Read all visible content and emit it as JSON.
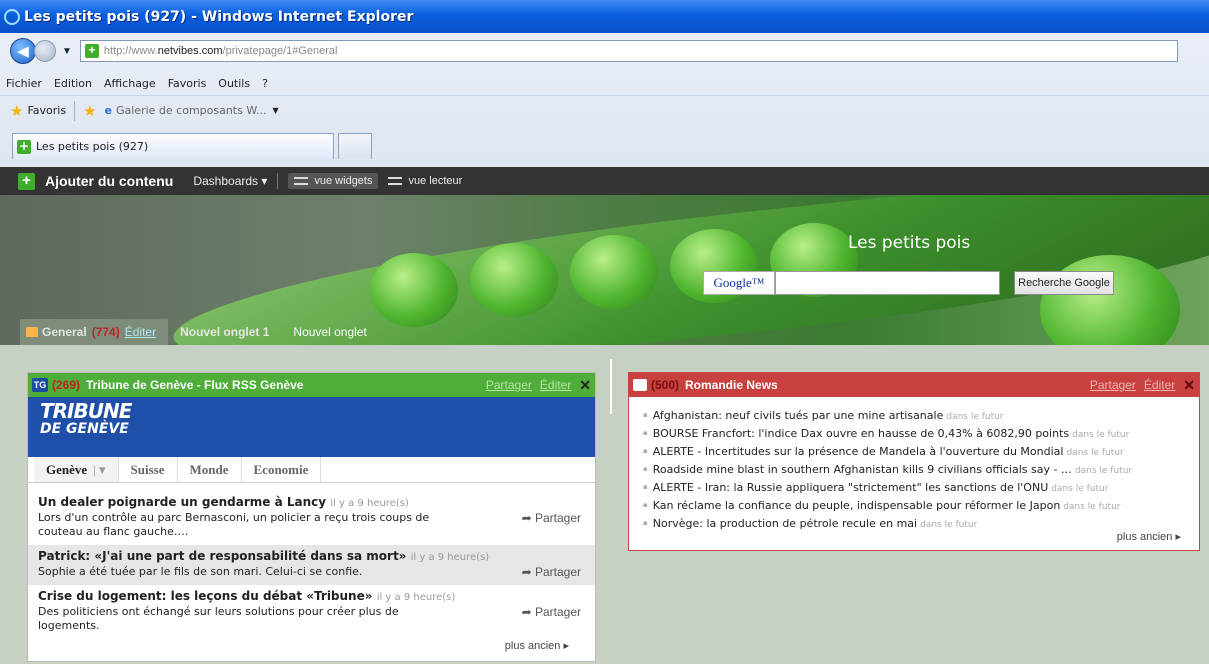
{
  "browser": {
    "title": "Les petits pois (927) - Windows Internet Explorer",
    "url_prefix": "http://www.",
    "url_domain": "netvibes.com",
    "url_rest": "/privatepage/1#General",
    "menu": [
      "Fichier",
      "Edition",
      "Affichage",
      "Favoris",
      "Outils",
      "?"
    ],
    "favorites_label": "Favoris",
    "gallery_label": "Galerie de composants W...",
    "tab_label": "Les petits pois (927)"
  },
  "nv": {
    "add_content": "Ajouter du contenu",
    "dashboards": "Dashboards ▾",
    "view_widgets": "vue widgets",
    "view_reader": "vue lecteur"
  },
  "header": {
    "title": "Les petits pois",
    "google": "Google™",
    "search_btn": "Recherche Google"
  },
  "page_tabs": [
    {
      "label": "General",
      "count": "(774)",
      "edit": "Éditer"
    },
    {
      "label": "Nouvel onglet 1"
    },
    {
      "label": "Nouvel onglet"
    }
  ],
  "w1": {
    "badge": "TG",
    "count": "(269)",
    "title": "Tribune de Genève - Flux RSS Genève",
    "share": "Partager",
    "edit": "Éditer",
    "close": "✕",
    "logo1": "TRIBUNE",
    "logo2": "DE GENÈVE",
    "tabs": [
      "Genève",
      "Suisse",
      "Monde",
      "Economie"
    ],
    "items": [
      {
        "title": "Un dealer poignarde un gendarme à Lancy",
        "time": "il y a 9 heure(s)",
        "desc": "Lors d'un contrôle au parc Bernasconi, un policier a reçu trois coups de couteau au flanc gauche….",
        "share": "Partager"
      },
      {
        "title": "Patrick: «J'ai une part de responsabilité dans sa mort»",
        "time": "il y a 9 heure(s)",
        "desc": "Sophie a été tuée par le fils de son mari. Celui-ci se confie.",
        "share": "Partager"
      },
      {
        "title": "Crise du logement: les leçons du débat «Tribune»",
        "time": "il y a 9 heure(s)",
        "desc": "Des politiciens ont échangé sur leurs solutions pour créer plus de logements.",
        "share": "Partager"
      }
    ],
    "more": "plus ancien ▸"
  },
  "w2": {
    "count": "(500)",
    "title": "Romandie News",
    "share": "Partager",
    "edit": "Éditer",
    "close": "✕",
    "when": "dans le futur",
    "items": [
      "Afghanistan: neuf civils tués par une mine artisanale",
      "BOURSE Francfort: l'indice Dax ouvre en hausse de 0,43% à 6082,90 points",
      "ALERTE - Incertitudes sur la présence de Mandela à l'ouverture du Mondial",
      "Roadside mine blast in southern Afghanistan kills 9 civilians officials say - …",
      "ALERTE - Iran: la Russie appliquera \"strictement\" les sanctions de l'ONU",
      "Kan réclame la confiance du peuple, indispensable pour réformer le Japon",
      "Norvège: la production de pétrole recule en mai"
    ],
    "more": "plus ancien ▸"
  }
}
